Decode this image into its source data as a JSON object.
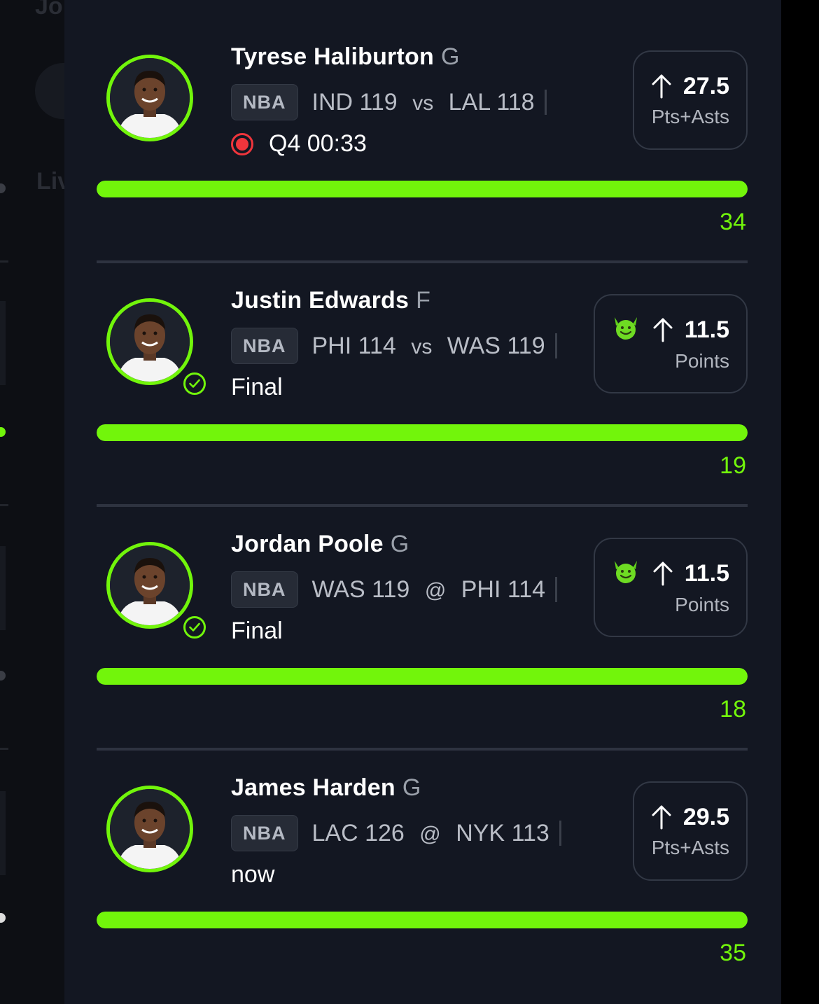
{
  "colors": {
    "accent": "#72f50b",
    "live": "#f0353c",
    "background": "#131722"
  },
  "background_app": {
    "partial_text_top": "Jo",
    "partial_text_mid": "Liv"
  },
  "picks": [
    {
      "player": "Tyrese Haliburton",
      "position": "G",
      "league": "NBA",
      "team1": "IND",
      "score1": "119",
      "separator": "vs",
      "team2": "LAL",
      "score2": "118",
      "status": "Q4 00:33",
      "status_type": "live",
      "direction_icon": "arrow-up-icon",
      "line": "27.5",
      "stat": "Pts+Asts",
      "actual": "34",
      "progress": 1.0,
      "completed": false,
      "boosted": false
    },
    {
      "player": "Justin Edwards",
      "position": "F",
      "league": "NBA",
      "team1": "PHI",
      "score1": "114",
      "separator": "vs",
      "team2": "WAS",
      "score2": "119",
      "status": "Final",
      "status_type": "final",
      "direction_icon": "arrow-up-icon",
      "line": "11.5",
      "stat": "Points",
      "actual": "19",
      "progress": 1.0,
      "completed": true,
      "boosted": true
    },
    {
      "player": "Jordan Poole",
      "position": "G",
      "league": "NBA",
      "team1": "WAS",
      "score1": "119",
      "separator": "@",
      "team2": "PHI",
      "score2": "114",
      "status": "Final",
      "status_type": "final",
      "direction_icon": "arrow-up-icon",
      "line": "11.5",
      "stat": "Points",
      "actual": "18",
      "progress": 1.0,
      "completed": true,
      "boosted": true
    },
    {
      "player": "James Harden",
      "position": "G",
      "league": "NBA",
      "team1": "LAC",
      "score1": "126",
      "separator": "@",
      "team2": "NYK",
      "score2": "113",
      "status": "now",
      "status_type": "upcoming",
      "direction_icon": "arrow-up-icon",
      "line": "29.5",
      "stat": "Pts+Asts",
      "actual": "35",
      "progress": 1.0,
      "completed": false,
      "boosted": false
    }
  ]
}
